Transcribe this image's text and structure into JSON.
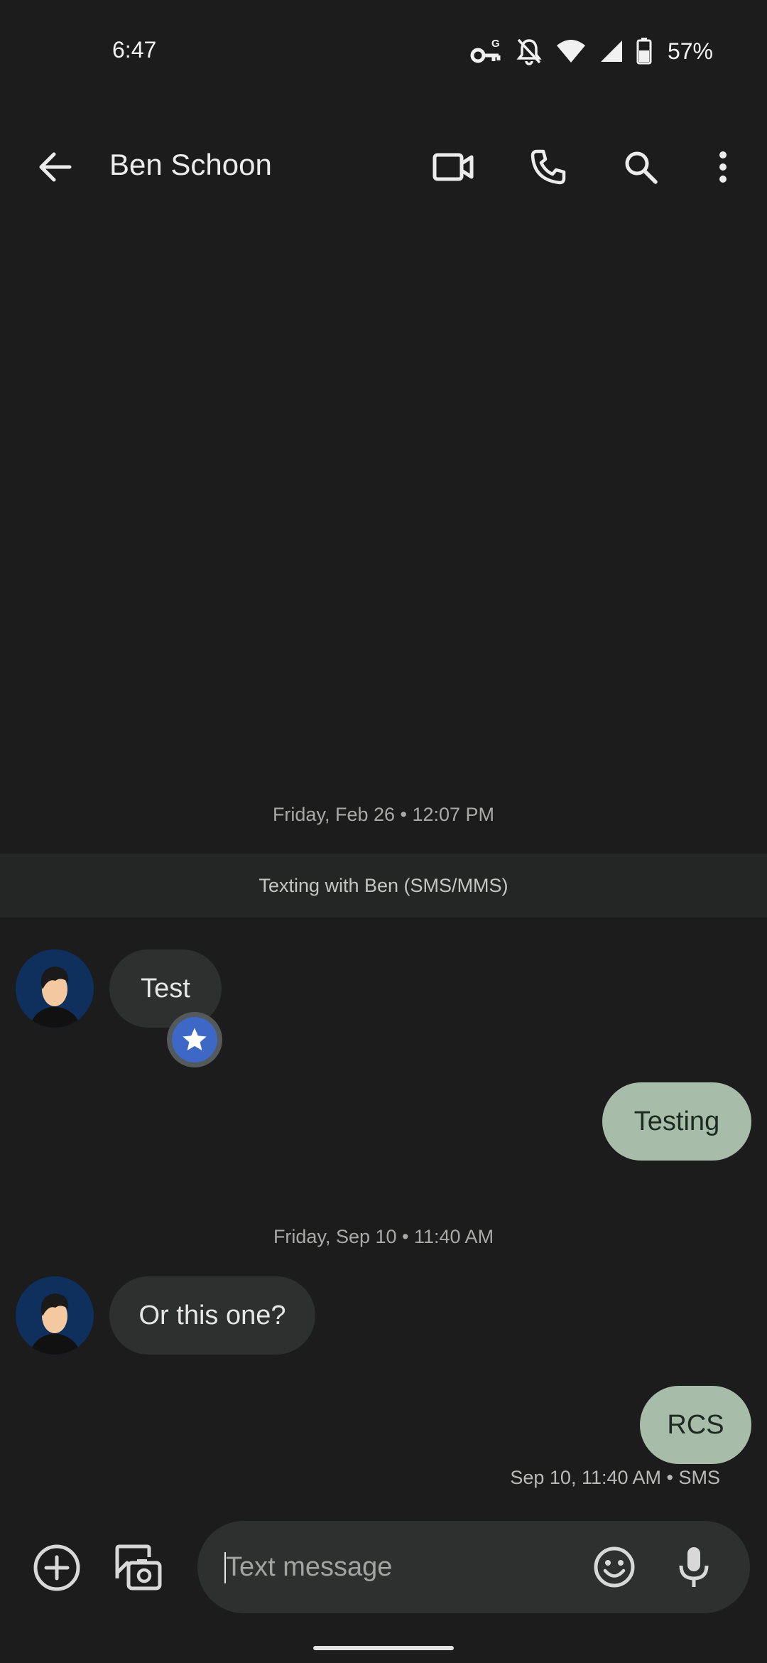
{
  "status_bar": {
    "time": "6:47",
    "battery": "57%",
    "icons": [
      "vpn-key-icon",
      "bell-off-icon",
      "wifi-icon",
      "cell-signal-icon",
      "battery-icon"
    ]
  },
  "app_bar": {
    "title": "Ben Schoon",
    "icons": [
      "back-arrow-icon",
      "video-call-icon",
      "phone-icon",
      "search-icon",
      "more-vert-icon"
    ]
  },
  "conversation": {
    "date_1": "Friday, Feb 26 • 12:07 PM",
    "info_banner": "Texting with Ben (SMS/MMS)",
    "messages": [
      {
        "direction": "incoming",
        "text": "Test",
        "reaction": "star"
      },
      {
        "direction": "outgoing",
        "text": "Testing"
      },
      {
        "direction": "incoming",
        "text": "Or this one?"
      },
      {
        "direction": "outgoing",
        "text": "RCS"
      }
    ],
    "date_2": "Friday, Sep 10 • 11:40 AM",
    "last_meta": "Sep 10, 11:40 AM • SMS"
  },
  "composer": {
    "placeholder": "Text message",
    "icons": [
      "add-circle-icon",
      "gallery-icon",
      "emoji-icon",
      "mic-icon"
    ]
  },
  "colors": {
    "background": "#1b1c1b",
    "incoming_bubble": "#2e302f",
    "outgoing_bubble": "#a8bcaa",
    "reaction": "#3d68c6"
  }
}
